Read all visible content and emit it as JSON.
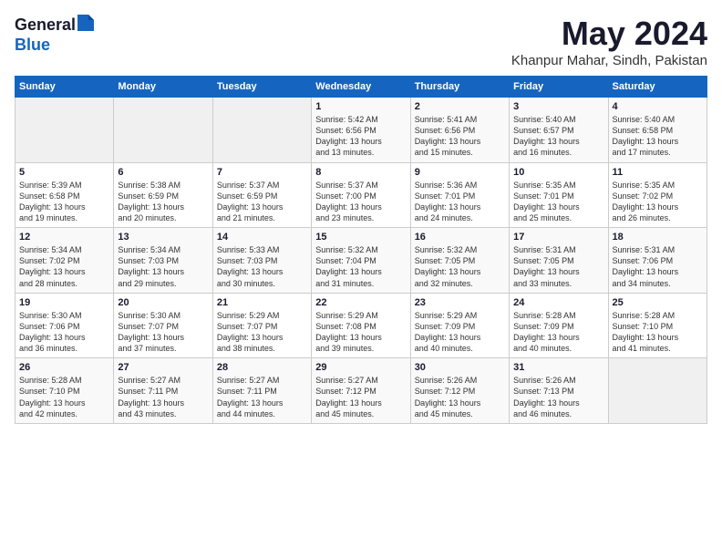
{
  "header": {
    "logo_general": "General",
    "logo_blue": "Blue",
    "title": "May 2024",
    "subtitle": "Khanpur Mahar, Sindh, Pakistan"
  },
  "weekdays": [
    "Sunday",
    "Monday",
    "Tuesday",
    "Wednesday",
    "Thursday",
    "Friday",
    "Saturday"
  ],
  "weeks": [
    [
      {
        "day": "",
        "info": ""
      },
      {
        "day": "",
        "info": ""
      },
      {
        "day": "",
        "info": ""
      },
      {
        "day": "1",
        "info": "Sunrise: 5:42 AM\nSunset: 6:56 PM\nDaylight: 13 hours\nand 13 minutes."
      },
      {
        "day": "2",
        "info": "Sunrise: 5:41 AM\nSunset: 6:56 PM\nDaylight: 13 hours\nand 15 minutes."
      },
      {
        "day": "3",
        "info": "Sunrise: 5:40 AM\nSunset: 6:57 PM\nDaylight: 13 hours\nand 16 minutes."
      },
      {
        "day": "4",
        "info": "Sunrise: 5:40 AM\nSunset: 6:58 PM\nDaylight: 13 hours\nand 17 minutes."
      }
    ],
    [
      {
        "day": "5",
        "info": "Sunrise: 5:39 AM\nSunset: 6:58 PM\nDaylight: 13 hours\nand 19 minutes."
      },
      {
        "day": "6",
        "info": "Sunrise: 5:38 AM\nSunset: 6:59 PM\nDaylight: 13 hours\nand 20 minutes."
      },
      {
        "day": "7",
        "info": "Sunrise: 5:37 AM\nSunset: 6:59 PM\nDaylight: 13 hours\nand 21 minutes."
      },
      {
        "day": "8",
        "info": "Sunrise: 5:37 AM\nSunset: 7:00 PM\nDaylight: 13 hours\nand 23 minutes."
      },
      {
        "day": "9",
        "info": "Sunrise: 5:36 AM\nSunset: 7:01 PM\nDaylight: 13 hours\nand 24 minutes."
      },
      {
        "day": "10",
        "info": "Sunrise: 5:35 AM\nSunset: 7:01 PM\nDaylight: 13 hours\nand 25 minutes."
      },
      {
        "day": "11",
        "info": "Sunrise: 5:35 AM\nSunset: 7:02 PM\nDaylight: 13 hours\nand 26 minutes."
      }
    ],
    [
      {
        "day": "12",
        "info": "Sunrise: 5:34 AM\nSunset: 7:02 PM\nDaylight: 13 hours\nand 28 minutes."
      },
      {
        "day": "13",
        "info": "Sunrise: 5:34 AM\nSunset: 7:03 PM\nDaylight: 13 hours\nand 29 minutes."
      },
      {
        "day": "14",
        "info": "Sunrise: 5:33 AM\nSunset: 7:03 PM\nDaylight: 13 hours\nand 30 minutes."
      },
      {
        "day": "15",
        "info": "Sunrise: 5:32 AM\nSunset: 7:04 PM\nDaylight: 13 hours\nand 31 minutes."
      },
      {
        "day": "16",
        "info": "Sunrise: 5:32 AM\nSunset: 7:05 PM\nDaylight: 13 hours\nand 32 minutes."
      },
      {
        "day": "17",
        "info": "Sunrise: 5:31 AM\nSunset: 7:05 PM\nDaylight: 13 hours\nand 33 minutes."
      },
      {
        "day": "18",
        "info": "Sunrise: 5:31 AM\nSunset: 7:06 PM\nDaylight: 13 hours\nand 34 minutes."
      }
    ],
    [
      {
        "day": "19",
        "info": "Sunrise: 5:30 AM\nSunset: 7:06 PM\nDaylight: 13 hours\nand 36 minutes."
      },
      {
        "day": "20",
        "info": "Sunrise: 5:30 AM\nSunset: 7:07 PM\nDaylight: 13 hours\nand 37 minutes."
      },
      {
        "day": "21",
        "info": "Sunrise: 5:29 AM\nSunset: 7:07 PM\nDaylight: 13 hours\nand 38 minutes."
      },
      {
        "day": "22",
        "info": "Sunrise: 5:29 AM\nSunset: 7:08 PM\nDaylight: 13 hours\nand 39 minutes."
      },
      {
        "day": "23",
        "info": "Sunrise: 5:29 AM\nSunset: 7:09 PM\nDaylight: 13 hours\nand 40 minutes."
      },
      {
        "day": "24",
        "info": "Sunrise: 5:28 AM\nSunset: 7:09 PM\nDaylight: 13 hours\nand 40 minutes."
      },
      {
        "day": "25",
        "info": "Sunrise: 5:28 AM\nSunset: 7:10 PM\nDaylight: 13 hours\nand 41 minutes."
      }
    ],
    [
      {
        "day": "26",
        "info": "Sunrise: 5:28 AM\nSunset: 7:10 PM\nDaylight: 13 hours\nand 42 minutes."
      },
      {
        "day": "27",
        "info": "Sunrise: 5:27 AM\nSunset: 7:11 PM\nDaylight: 13 hours\nand 43 minutes."
      },
      {
        "day": "28",
        "info": "Sunrise: 5:27 AM\nSunset: 7:11 PM\nDaylight: 13 hours\nand 44 minutes."
      },
      {
        "day": "29",
        "info": "Sunrise: 5:27 AM\nSunset: 7:12 PM\nDaylight: 13 hours\nand 45 minutes."
      },
      {
        "day": "30",
        "info": "Sunrise: 5:26 AM\nSunset: 7:12 PM\nDaylight: 13 hours\nand 45 minutes."
      },
      {
        "day": "31",
        "info": "Sunrise: 5:26 AM\nSunset: 7:13 PM\nDaylight: 13 hours\nand 46 minutes."
      },
      {
        "day": "",
        "info": ""
      }
    ]
  ]
}
